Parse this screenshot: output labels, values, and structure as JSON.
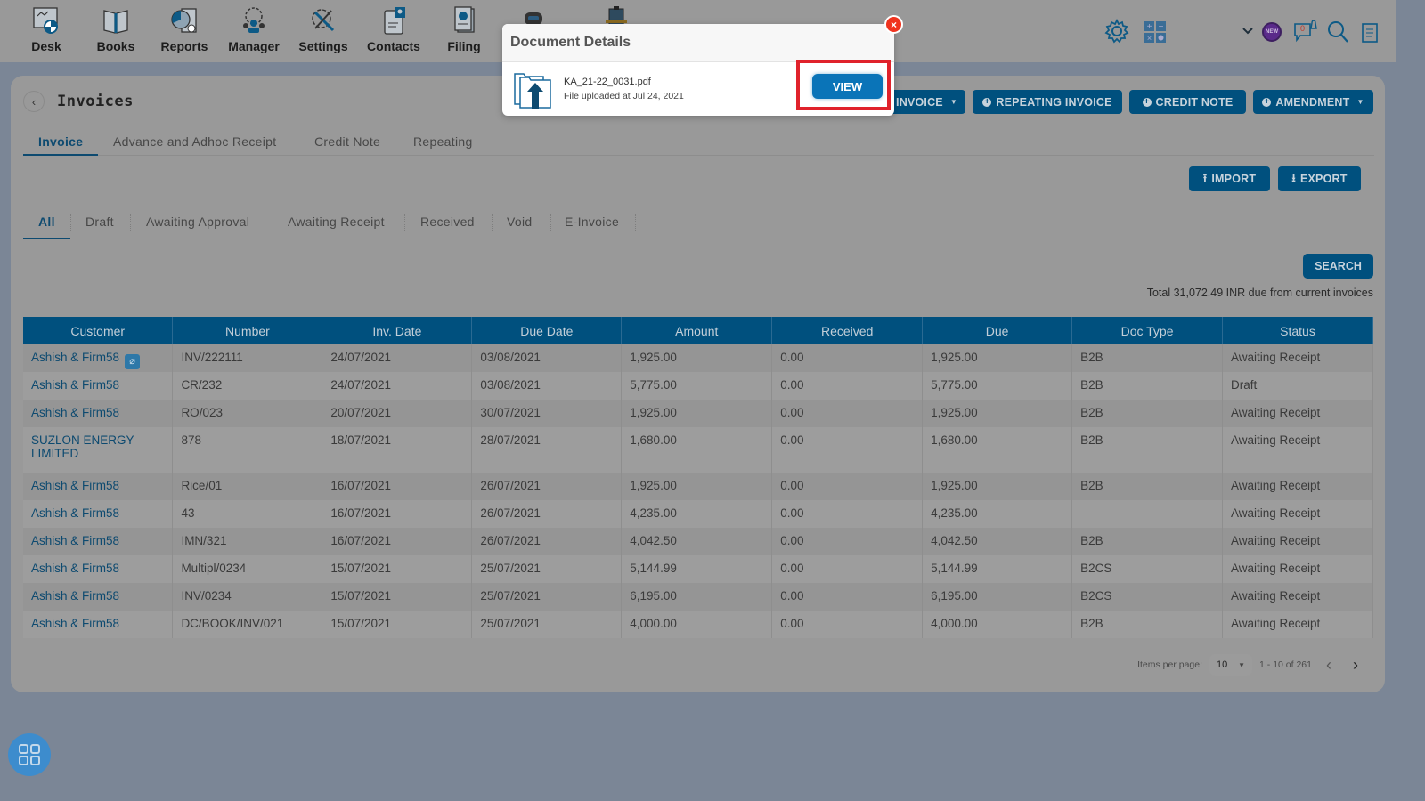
{
  "nav": {
    "items": [
      {
        "label": "Desk",
        "icon": "desk-icon"
      },
      {
        "label": "Books",
        "icon": "books-icon"
      },
      {
        "label": "Reports",
        "icon": "reports-icon"
      },
      {
        "label": "Manager",
        "icon": "manager-icon"
      },
      {
        "label": "Settings",
        "icon": "settings-tools-icon"
      },
      {
        "label": "Contacts",
        "icon": "contacts-icon"
      },
      {
        "label": "Filing",
        "icon": "filing-icon"
      }
    ],
    "right_icons": [
      "gear-icon",
      "calculator-icon",
      "chevron-down-icon",
      "new-badge-icon",
      "notification-icon",
      "search-icon",
      "clipboard-icon"
    ],
    "notification_count": "0",
    "new_badge": "NEW"
  },
  "page": {
    "title": "Invoices",
    "back_icon": "chevron-left-icon"
  },
  "main_tabs": [
    {
      "label": "Invoice",
      "active": true
    },
    {
      "label": "Advance and Adhoc Receipt",
      "active": false
    },
    {
      "label": "Credit Note",
      "active": false
    },
    {
      "label": "Repeating",
      "active": false
    }
  ],
  "actions": {
    "invoice": "INVOICE",
    "repeating_invoice": "REPEATING INVOICE",
    "credit_note": "CREDIT NOTE",
    "amendment": "AMENDMENT",
    "import": "IMPORT",
    "export": "EXPORT",
    "search": "SEARCH"
  },
  "status_tabs": [
    {
      "label": "All",
      "active": true
    },
    {
      "label": "Draft",
      "active": false
    },
    {
      "label": "Awaiting Approval",
      "active": false
    },
    {
      "label": "Awaiting Receipt",
      "active": false
    },
    {
      "label": "Received",
      "active": false
    },
    {
      "label": "Void",
      "active": false
    },
    {
      "label": "E-Invoice",
      "active": false
    }
  ],
  "total_text": "Total 31,072.49 INR due from current invoices",
  "table": {
    "columns": [
      "Customer",
      "Number",
      "Inv. Date",
      "Due Date",
      "Amount",
      "Received",
      "Due",
      "Doc Type",
      "Status"
    ],
    "rows": [
      {
        "customer": "Ashish & Firm58",
        "attachment": true,
        "number": "INV/222111",
        "inv_date": "24/07/2021",
        "due_date": "03/08/2021",
        "amount": "1,925.00",
        "received": "0.00",
        "due": "1,925.00",
        "doc_type": "B2B",
        "status": "Awaiting Receipt"
      },
      {
        "customer": "Ashish & Firm58",
        "attachment": false,
        "number": "CR/232",
        "inv_date": "24/07/2021",
        "due_date": "03/08/2021",
        "amount": "5,775.00",
        "received": "0.00",
        "due": "5,775.00",
        "doc_type": "B2B",
        "status": "Draft"
      },
      {
        "customer": "Ashish & Firm58",
        "attachment": false,
        "number": "RO/023",
        "inv_date": "20/07/2021",
        "due_date": "30/07/2021",
        "amount": "1,925.00",
        "received": "0.00",
        "due": "1,925.00",
        "doc_type": "B2B",
        "status": "Awaiting Receipt"
      },
      {
        "customer": "SUZLON ENERGY LIMITED",
        "attachment": false,
        "number": "878",
        "inv_date": "18/07/2021",
        "due_date": "28/07/2021",
        "amount": "1,680.00",
        "received": "0.00",
        "due": "1,680.00",
        "doc_type": "B2B",
        "status": "Awaiting Receipt"
      },
      {
        "customer": "Ashish & Firm58",
        "attachment": false,
        "number": "Rice/01",
        "inv_date": "16/07/2021",
        "due_date": "26/07/2021",
        "amount": "1,925.00",
        "received": "0.00",
        "due": "1,925.00",
        "doc_type": "B2B",
        "status": "Awaiting Receipt"
      },
      {
        "customer": "Ashish & Firm58",
        "attachment": false,
        "number": "43",
        "inv_date": "16/07/2021",
        "due_date": "26/07/2021",
        "amount": "4,235.00",
        "received": "0.00",
        "due": "4,235.00",
        "doc_type": "",
        "status": "Awaiting Receipt"
      },
      {
        "customer": "Ashish & Firm58",
        "attachment": false,
        "number": "IMN/321",
        "inv_date": "16/07/2021",
        "due_date": "26/07/2021",
        "amount": "4,042.50",
        "received": "0.00",
        "due": "4,042.50",
        "doc_type": "B2B",
        "status": "Awaiting Receipt"
      },
      {
        "customer": "Ashish & Firm58",
        "attachment": false,
        "number": "Multipl/0234",
        "inv_date": "15/07/2021",
        "due_date": "25/07/2021",
        "amount": "5,144.99",
        "received": "0.00",
        "due": "5,144.99",
        "doc_type": "B2CS",
        "status": "Awaiting Receipt"
      },
      {
        "customer": "Ashish & Firm58",
        "attachment": false,
        "number": "INV/0234",
        "inv_date": "15/07/2021",
        "due_date": "25/07/2021",
        "amount": "6,195.00",
        "received": "0.00",
        "due": "6,195.00",
        "doc_type": "B2CS",
        "status": "Awaiting Receipt"
      },
      {
        "customer": "Ashish & Firm58",
        "attachment": false,
        "number": "DC/BOOK/INV/021",
        "inv_date": "15/07/2021",
        "due_date": "25/07/2021",
        "amount": "4,000.00",
        "received": "0.00",
        "due": "4,000.00",
        "doc_type": "B2B",
        "status": "Awaiting Receipt"
      }
    ]
  },
  "pagination": {
    "items_per_page_label": "Items per page:",
    "items_per_page": "10",
    "range": "1 - 10 of 261"
  },
  "modal": {
    "title": "Document Details",
    "file_name": "KA_21-22_0031.pdf",
    "uploaded_text": "File uploaded at Jul 24, 2021",
    "view_label": "VIEW",
    "close_label": "×"
  },
  "colors": {
    "primary": "#00507e",
    "view_button": "#0a74b8",
    "highlight": "#e0222b",
    "close": "#f0331e"
  }
}
